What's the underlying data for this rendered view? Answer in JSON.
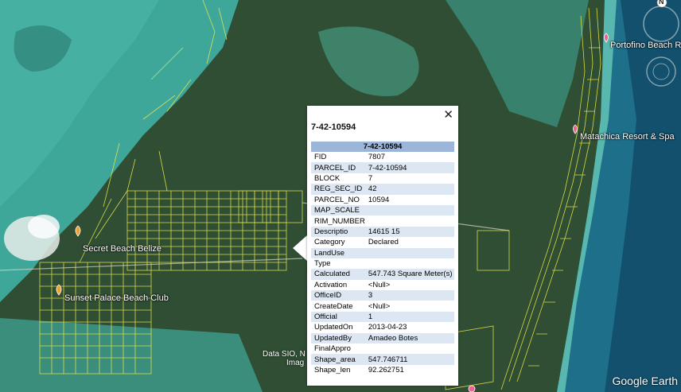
{
  "map": {
    "places": [
      {
        "name": "Secret Beach Belize"
      },
      {
        "name": "Sunset Palace Beach Club"
      },
      {
        "name": "Portofino Beach Resort"
      },
      {
        "name": "Matachica Resort & Spa"
      }
    ],
    "attribution": "Data SIO, N",
    "attribution2": "Imag",
    "logo": "Google Earth",
    "compass_label": "N"
  },
  "popup": {
    "title": "7-42-10594",
    "table_header": "7-42-10594",
    "close_icon": "close-icon",
    "rows": [
      {
        "k": "FID",
        "v": "7807"
      },
      {
        "k": "PARCEL_ID",
        "v": "7-42-10594"
      },
      {
        "k": "BLOCK",
        "v": "7"
      },
      {
        "k": "REG_SEC_ID",
        "v": "42"
      },
      {
        "k": "PARCEL_NO",
        "v": "10594"
      },
      {
        "k": "MAP_SCALE",
        "v": ""
      },
      {
        "k": "RIM_NUMBER",
        "v": ""
      },
      {
        "k": "Descriptio",
        "v": "14615 15"
      },
      {
        "k": "Category",
        "v": "Declared"
      },
      {
        "k": "LandUse",
        "v": ""
      },
      {
        "k": "Type",
        "v": ""
      },
      {
        "k": "Calculated",
        "v": "547.743 Square Meter(s)"
      },
      {
        "k": "Activation",
        "v": "<Null>"
      },
      {
        "k": "OfficeID",
        "v": "3"
      },
      {
        "k": "CreateDate",
        "v": "<Null>"
      },
      {
        "k": "Official",
        "v": "1"
      },
      {
        "k": "UpdatedOn",
        "v": "2013-04-23"
      },
      {
        "k": "UpdatedBy",
        "v": "Amadeo Botes"
      },
      {
        "k": "FinalAppro",
        "v": ""
      },
      {
        "k": "Shape_area",
        "v": "547.746711"
      },
      {
        "k": "Shape_len",
        "v": "92.262751"
      }
    ]
  },
  "colors": {
    "lagoon": "#3fa69a",
    "sea": "#1e6f8a",
    "land": "#2f4e34",
    "parcel": "#e8e84a",
    "header": "#9bb6d9",
    "row_alt": "#dde6f3",
    "pin_orange": "#f0a030",
    "pin_pink": "#f06090"
  }
}
